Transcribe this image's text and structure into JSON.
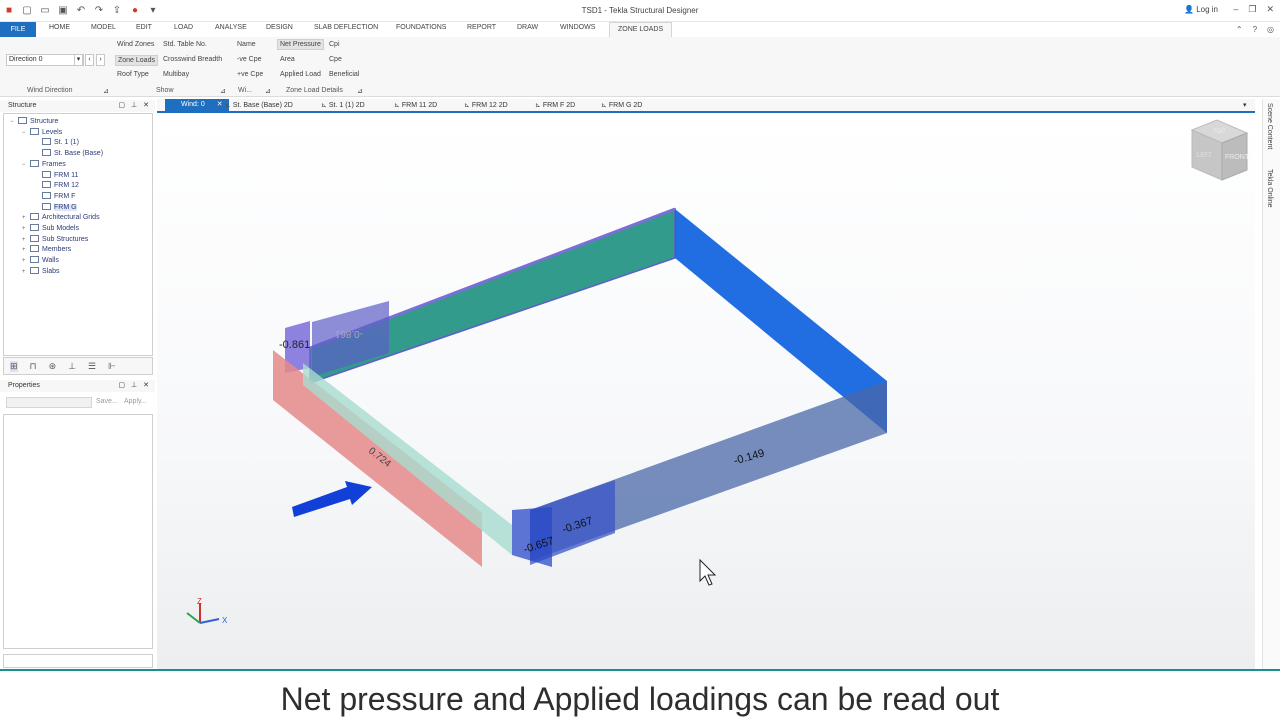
{
  "app": {
    "title": "TSD1 - Tekla Structural Designer",
    "login_label": "Log in"
  },
  "ribbon_tabs": [
    "FILE",
    "HOME",
    "MODEL",
    "EDIT",
    "LOAD",
    "ANALYSE",
    "DESIGN",
    "SLAB DEFLECTION",
    "FOUNDATIONS",
    "REPORT",
    "DRAW",
    "WINDOWS",
    "ZONE LOADS"
  ],
  "ribbon": {
    "direction_value": "Direction 0",
    "wind_zones": "Wind Zones",
    "zone_loads": "Zone Loads",
    "roof_type": "Roof Type",
    "std_table_no": "Std. Table No.",
    "crosswind_breadth": "Crosswind Breadth",
    "multibay": "Multibay",
    "name": "Name",
    "neg_cpe": "-ve Cpe",
    "pos_cpe": "+ve Cpe",
    "net_pressure": "Net Pressure",
    "area": "Area",
    "applied_load": "Applied Load",
    "cpi": "Cpi",
    "cpe": "Cpe",
    "beneficial": "Beneficial",
    "groups": {
      "wind_direction": "Wind Direction",
      "show": "Show",
      "wi": "Wi...",
      "zone_load_details": "Zone Load Details"
    }
  },
  "structure_panel": {
    "title": "Structure",
    "nodes": [
      {
        "label": "Structure",
        "level": 0,
        "expander": "−"
      },
      {
        "label": "Levels",
        "level": 1,
        "expander": "−"
      },
      {
        "label": "St. 1 (1)",
        "level": 2,
        "expander": ""
      },
      {
        "label": "St. Base (Base)",
        "level": 2,
        "expander": ""
      },
      {
        "label": "Frames",
        "level": 1,
        "expander": "−"
      },
      {
        "label": "FRM 11",
        "level": 2,
        "expander": ""
      },
      {
        "label": "FRM 12",
        "level": 2,
        "expander": ""
      },
      {
        "label": "FRM F",
        "level": 2,
        "expander": ""
      },
      {
        "label": "FRM G",
        "level": 2,
        "expander": "",
        "selected": true
      },
      {
        "label": "Architectural Grids",
        "level": 1,
        "expander": "+"
      },
      {
        "label": "Sub Models",
        "level": 1,
        "expander": "+"
      },
      {
        "label": "Sub Structures",
        "level": 1,
        "expander": "+"
      },
      {
        "label": "Members",
        "level": 1,
        "expander": "+"
      },
      {
        "label": "Walls",
        "level": 1,
        "expander": "+"
      },
      {
        "label": "Slabs",
        "level": 1,
        "expander": "+"
      }
    ]
  },
  "properties_panel": {
    "title": "Properties",
    "save_label": "Save...",
    "apply_label": "Apply..."
  },
  "view_tabs": [
    {
      "label": "Wind: 0",
      "active": true
    },
    {
      "label": "St. Base (Base) 2D"
    },
    {
      "label": "St. 1 (1) 2D"
    },
    {
      "label": "FRM 11 2D"
    },
    {
      "label": "FRM 12 2D"
    },
    {
      "label": "FRM F 2D"
    },
    {
      "label": "FRM G 2D"
    }
  ],
  "side_tabs": [
    "Scene Content",
    "Tekla Online"
  ],
  "viewport": {
    "zone_labels": [
      "-0.861",
      "-0.861",
      "0.724",
      "-0.367",
      "-0.657",
      "-0.149"
    ],
    "view_cube": {
      "top": "TOP",
      "front": "FRONT",
      "left": "LEFT"
    },
    "axes": {
      "z": "Z",
      "x": "X"
    }
  },
  "colors": {
    "accent": "#1e6fc0",
    "zone_teal": "#0e8a78",
    "zone_blue": "#1565e0",
    "zone_red": "#e58a8a",
    "zone_violet": "#5e5ec8",
    "caption_rule": "#1a8f8f"
  },
  "caption": "Net pressure and Applied loadings can be read out"
}
